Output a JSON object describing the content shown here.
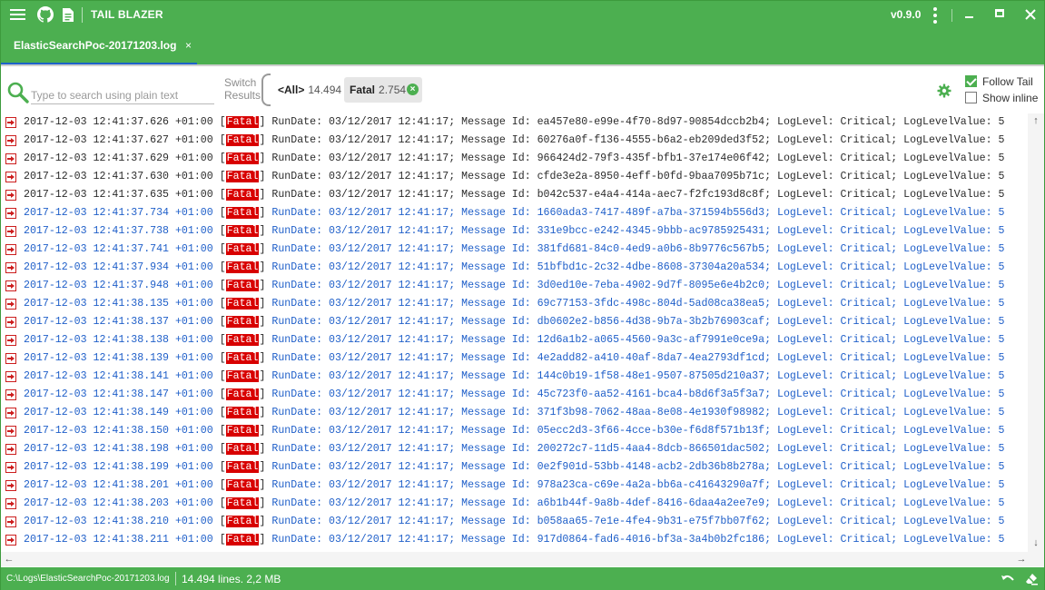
{
  "app": {
    "title": "TAIL BLAZER",
    "version": "v0.9.0"
  },
  "tabs": [
    {
      "label": "ElasticSearchPoc-20171203.log",
      "close": "×"
    }
  ],
  "toolbar": {
    "search_placeholder": "Type to search using plain text",
    "switch_line1": "Switch",
    "switch_line2": "Results",
    "chips": [
      {
        "name": "<All>",
        "count": "14.494"
      },
      {
        "name": "Fatal",
        "count": "2.754",
        "remove": "×"
      }
    ],
    "follow_tail": "Follow Tail",
    "follow_tail_checked": true,
    "show_inline": "Show inline",
    "show_inline_checked": false
  },
  "log": {
    "level": "Fatal",
    "rows": [
      {
        "ts": "2017-12-03 12:41:37.626 +01:00",
        "rest": " RunDate: 03/12/2017 12:41:17; Message Id: ea457e80-e99e-4f70-8d97-90854dccb2b4; LogLevel: Critical; LogLevelValue: 5",
        "hl": false
      },
      {
        "ts": "2017-12-03 12:41:37.627 +01:00",
        "rest": " RunDate: 03/12/2017 12:41:17; Message Id: 60276a0f-f136-4555-b6a2-eb209ded3f52; LogLevel: Critical; LogLevelValue: 5",
        "hl": false
      },
      {
        "ts": "2017-12-03 12:41:37.629 +01:00",
        "rest": " RunDate: 03/12/2017 12:41:17; Message Id: 966424d2-79f3-435f-bfb1-37e174e06f42; LogLevel: Critical; LogLevelValue: 5",
        "hl": false
      },
      {
        "ts": "2017-12-03 12:41:37.630 +01:00",
        "rest": " RunDate: 03/12/2017 12:41:17; Message Id: cfde3e2a-8950-4eff-b0fd-9baa7095b71c; LogLevel: Critical; LogLevelValue: 5",
        "hl": false
      },
      {
        "ts": "2017-12-03 12:41:37.635 +01:00",
        "rest": " RunDate: 03/12/2017 12:41:17; Message Id: b042c537-e4a4-414a-aec7-f2fc193d8c8f; LogLevel: Critical; LogLevelValue: 5",
        "hl": false
      },
      {
        "ts": "2017-12-03 12:41:37.734 +01:00",
        "rest": " RunDate: 03/12/2017 12:41:17; Message Id: 1660ada3-7417-489f-a7ba-371594b556d3; LogLevel: Critical; LogLevelValue: 5",
        "hl": true
      },
      {
        "ts": "2017-12-03 12:41:37.738 +01:00",
        "rest": " RunDate: 03/12/2017 12:41:17; Message Id: 331e9bcc-e242-4345-9bbb-ac9785925431; LogLevel: Critical; LogLevelValue: 5",
        "hl": true
      },
      {
        "ts": "2017-12-03 12:41:37.741 +01:00",
        "rest": " RunDate: 03/12/2017 12:41:17; Message Id: 381fd681-84c0-4ed9-a0b6-8b9776c567b5; LogLevel: Critical; LogLevelValue: 5",
        "hl": true
      },
      {
        "ts": "2017-12-03 12:41:37.934 +01:00",
        "rest": " RunDate: 03/12/2017 12:41:17; Message Id: 51bfbd1c-2c32-4dbe-8608-37304a20a534; LogLevel: Critical; LogLevelValue: 5",
        "hl": true
      },
      {
        "ts": "2017-12-03 12:41:37.948 +01:00",
        "rest": " RunDate: 03/12/2017 12:41:17; Message Id: 3d0ed10e-7eba-4902-9d7f-8095e6e4b2c0; LogLevel: Critical; LogLevelValue: 5",
        "hl": true
      },
      {
        "ts": "2017-12-03 12:41:38.135 +01:00",
        "rest": " RunDate: 03/12/2017 12:41:17; Message Id: 69c77153-3fdc-498c-804d-5ad08ca38ea5; LogLevel: Critical; LogLevelValue: 5",
        "hl": true
      },
      {
        "ts": "2017-12-03 12:41:38.137 +01:00",
        "rest": " RunDate: 03/12/2017 12:41:17; Message Id: db0602e2-b856-4d38-9b7a-3b2b76903caf; LogLevel: Critical; LogLevelValue: 5",
        "hl": true
      },
      {
        "ts": "2017-12-03 12:41:38.138 +01:00",
        "rest": " RunDate: 03/12/2017 12:41:17; Message Id: 12d6a1b2-a065-4560-9a3c-af7991e0ce9a; LogLevel: Critical; LogLevelValue: 5",
        "hl": true
      },
      {
        "ts": "2017-12-03 12:41:38.139 +01:00",
        "rest": " RunDate: 03/12/2017 12:41:17; Message Id: 4e2add82-a410-40af-8da7-4ea2793df1cd; LogLevel: Critical; LogLevelValue: 5",
        "hl": true
      },
      {
        "ts": "2017-12-03 12:41:38.141 +01:00",
        "rest": " RunDate: 03/12/2017 12:41:17; Message Id: 144c0b19-1f58-48e1-9507-87505d210a37; LogLevel: Critical; LogLevelValue: 5",
        "hl": true
      },
      {
        "ts": "2017-12-03 12:41:38.147 +01:00",
        "rest": " RunDate: 03/12/2017 12:41:17; Message Id: 45c723f0-aa52-4161-bca4-b8d6f3a5f3a7; LogLevel: Critical; LogLevelValue: 5",
        "hl": true
      },
      {
        "ts": "2017-12-03 12:41:38.149 +01:00",
        "rest": " RunDate: 03/12/2017 12:41:17; Message Id: 371f3b98-7062-48aa-8e08-4e1930f98982; LogLevel: Critical; LogLevelValue: 5",
        "hl": true
      },
      {
        "ts": "2017-12-03 12:41:38.150 +01:00",
        "rest": " RunDate: 03/12/2017 12:41:17; Message Id: 05ecc2d3-3f66-4cce-b30e-f6d8f571b13f; LogLevel: Critical; LogLevelValue: 5",
        "hl": true
      },
      {
        "ts": "2017-12-03 12:41:38.198 +01:00",
        "rest": " RunDate: 03/12/2017 12:41:17; Message Id: 200272c7-11d5-4aa4-8dcb-866501dac502; LogLevel: Critical; LogLevelValue: 5",
        "hl": true
      },
      {
        "ts": "2017-12-03 12:41:38.199 +01:00",
        "rest": " RunDate: 03/12/2017 12:41:17; Message Id: 0e2f901d-53bb-4148-acb2-2db36b8b278a; LogLevel: Critical; LogLevelValue: 5",
        "hl": true
      },
      {
        "ts": "2017-12-03 12:41:38.201 +01:00",
        "rest": " RunDate: 03/12/2017 12:41:17; Message Id: 978a23ca-c69e-4a2a-bb6a-c41643290a7f; LogLevel: Critical; LogLevelValue: 5",
        "hl": true
      },
      {
        "ts": "2017-12-03 12:41:38.203 +01:00",
        "rest": " RunDate: 03/12/2017 12:41:17; Message Id: a6b1b44f-9a8b-4def-8416-6daa4a2ee7e9; LogLevel: Critical; LogLevelValue: 5",
        "hl": true
      },
      {
        "ts": "2017-12-03 12:41:38.210 +01:00",
        "rest": " RunDate: 03/12/2017 12:41:17; Message Id: b058aa65-7e1e-4fe4-9b31-e75f7bb07f62; LogLevel: Critical; LogLevelValue: 5",
        "hl": true
      },
      {
        "ts": "2017-12-03 12:41:38.211 +01:00",
        "rest": " RunDate: 03/12/2017 12:41:17; Message Id: 917d0864-fad6-4016-bf3a-3a4b0b2fc186; LogLevel: Critical; LogLevelValue: 5",
        "hl": true
      }
    ]
  },
  "status": {
    "path": "C:\\Logs\\ElasticSearchPoc-20171203.log",
    "lines": "14.494 lines.  2,2 MB"
  },
  "icons": {
    "menu": "hamburger-icon",
    "github": "github-icon",
    "file": "document-icon",
    "search": "search-icon",
    "settings": "gear-icon",
    "log_level": "log-entry-icon",
    "undo": "undo-icon",
    "clear": "eraser-icon"
  },
  "colors": {
    "accent": "#4caf50",
    "tab_underline": "#1e63c8",
    "highlight_text": "#1f5fc9",
    "fatal_badge": "#d80000"
  }
}
